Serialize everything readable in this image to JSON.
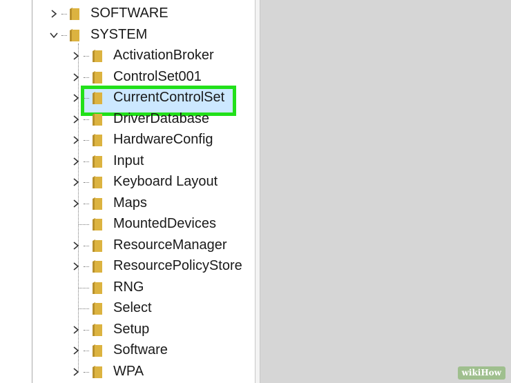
{
  "tree": {
    "root_items": [
      {
        "label": "SOFTWARE",
        "expanded": false
      },
      {
        "label": "SYSTEM",
        "expanded": true
      }
    ],
    "system_children": [
      {
        "label": "ActivationBroker",
        "has_children": true
      },
      {
        "label": "ControlSet001",
        "has_children": true
      },
      {
        "label": "CurrentControlSet",
        "has_children": true,
        "selected": true
      },
      {
        "label": "DriverDatabase",
        "has_children": true
      },
      {
        "label": "HardwareConfig",
        "has_children": true
      },
      {
        "label": "Input",
        "has_children": true
      },
      {
        "label": "Keyboard Layout",
        "has_children": true
      },
      {
        "label": "Maps",
        "has_children": true
      },
      {
        "label": "MountedDevices",
        "has_children": false
      },
      {
        "label": "ResourceManager",
        "has_children": true
      },
      {
        "label": "ResourcePolicyStore",
        "has_children": true
      },
      {
        "label": "RNG",
        "has_children": false
      },
      {
        "label": "Select",
        "has_children": false
      },
      {
        "label": "Setup",
        "has_children": true
      },
      {
        "label": "Software",
        "has_children": true
      },
      {
        "label": "WPA",
        "has_children": true
      }
    ]
  },
  "colors": {
    "highlight_border": "#22e01a",
    "selection_fill": "#cce8ff",
    "folder": "#dcb340"
  },
  "watermark": {
    "wiki": "wiki",
    "how": "How"
  }
}
